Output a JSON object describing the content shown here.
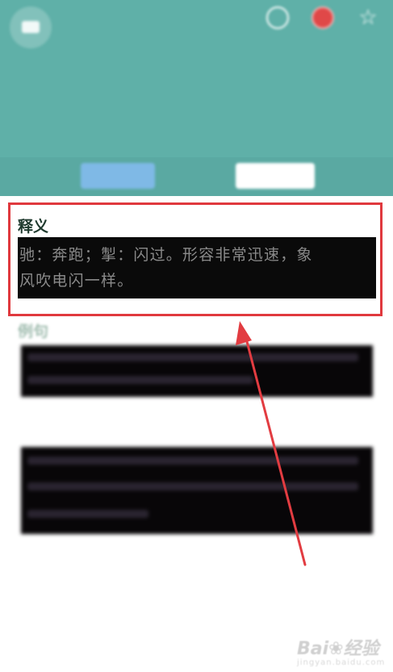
{
  "definition": {
    "title": "释义",
    "line1": "驰：奔跑；掣：闪过。形容非常迅速，象",
    "line2": "风吹电闪一样。"
  },
  "example": {
    "title": "例句"
  },
  "icons": {
    "back": "back-icon",
    "share": "share-icon",
    "favorite": "favorite-icon",
    "home": "home-icon"
  },
  "colors": {
    "header": "#5fb0a8",
    "highlight": "#e0393e",
    "arrow": "#e23c41"
  }
}
